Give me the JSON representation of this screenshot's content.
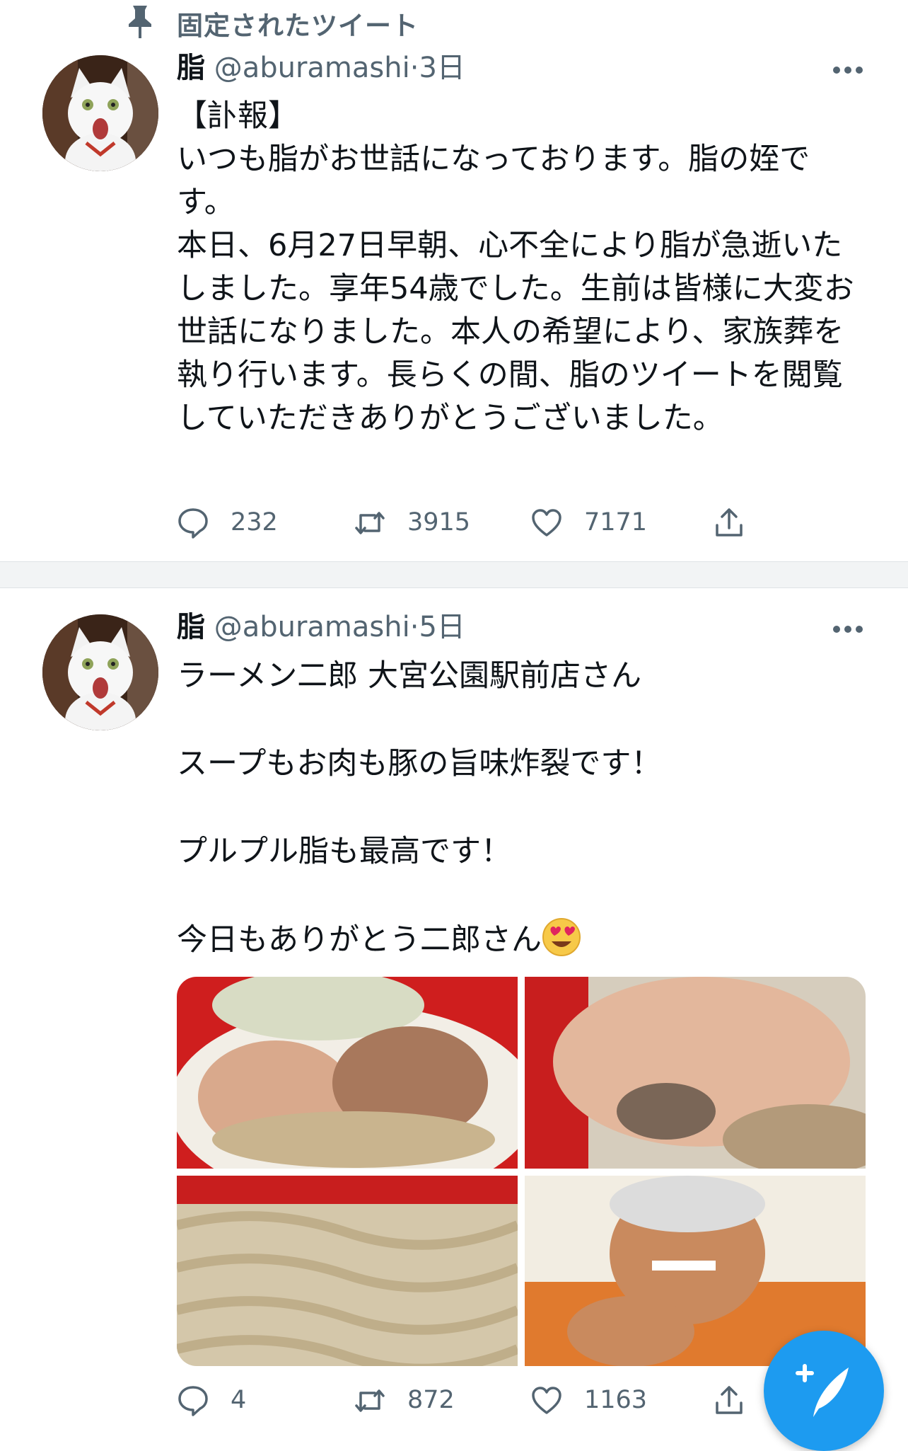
{
  "pinned": {
    "label": "固定されたツイート",
    "icon": "pin-icon"
  },
  "tweets": [
    {
      "name": "脂",
      "handle": "@aburamashi",
      "dot": "·",
      "time": "3日",
      "text": "【訃報】\nいつも脂がお世話になっております。脂の姪です。\n本日、6月27日早朝、心不全により脂が急逝いたしました。享年54歳でした。生前は皆様に大変お世話になりました。本人の希望により、家族葬を執り行います。長らくの間、脂のツイートを閲覧していただきありがとうございました。",
      "replies": "232",
      "retweets": "3915",
      "likes": "7171"
    },
    {
      "name": "脂",
      "handle": "@aburamashi",
      "dot": "·",
      "time": "5日",
      "text": "ラーメン二郎 大宮公園駅前店さん\n\nスープもお肉も豚の旨味炸裂です！\n\nプルプル脂も最高です！\n\n今日もありがとう二郎さん",
      "emoji": "heart-eyes-emoji",
      "replies": "4",
      "retweets": "872",
      "likes": "1163"
    }
  ],
  "colors": {
    "accent": "#1d9bf0",
    "muted": "#536471",
    "text": "#0f1419"
  }
}
